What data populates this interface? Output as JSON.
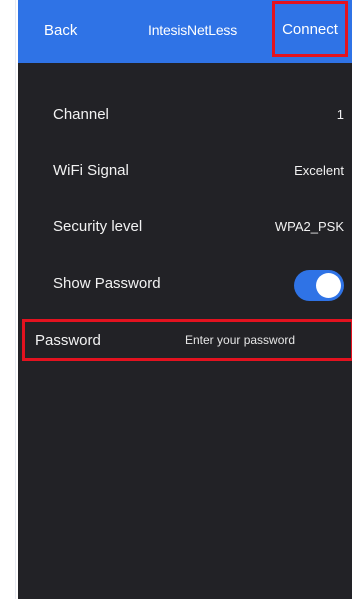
{
  "navbar": {
    "back_label": "Back",
    "title": "IntesisNetLess",
    "connect_label": "Connect"
  },
  "details": {
    "channel": {
      "label": "Channel",
      "value": "1"
    },
    "wifi_signal": {
      "label": "WiFi Signal",
      "value": "Excelent"
    },
    "security_level": {
      "label": "Security level",
      "value": "WPA2_PSK"
    },
    "show_password": {
      "label": "Show Password",
      "enabled": true
    }
  },
  "password": {
    "label": "Password",
    "value": "",
    "placeholder": "Enter your password"
  },
  "colors": {
    "accent": "#2f73e6",
    "background": "#222226",
    "highlight": "#e3121f"
  }
}
